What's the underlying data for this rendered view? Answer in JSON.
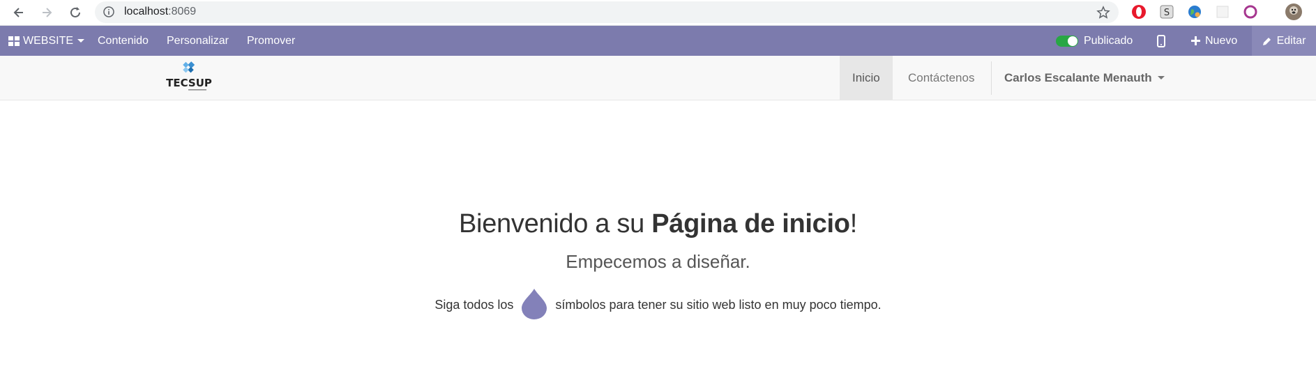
{
  "browser": {
    "url_host": "localhost",
    "url_port": ":8069",
    "icons": [
      "back-icon",
      "forward-icon",
      "reload-icon",
      "info-icon",
      "star-icon",
      "opera-icon",
      "s-extension-icon",
      "globe-extension-icon",
      "blank-extension-icon",
      "ring-extension-icon",
      "profile-avatar"
    ]
  },
  "odoo_bar": {
    "app_menu": "WEBSITE",
    "items": [
      "Contenido",
      "Personalizar",
      "Promover"
    ],
    "published_label": "Publicado",
    "new_label": "Nuevo",
    "edit_label": "Editar",
    "color": "#7c7bad"
  },
  "site_nav": {
    "logo_text": "TECSUP",
    "menu": [
      "Inicio",
      "Contáctenos"
    ],
    "active": "Inicio",
    "user": "Carlos Escalante Menauth"
  },
  "main": {
    "headline_pre": "Bienvenido a su ",
    "headline_bold": "Página de inicio",
    "headline_post": "!",
    "subheadline": "Empecemos a diseñar.",
    "tip_pre": "Siga todos los",
    "tip_post": "símbolos para tener su sitio web listo en muy poco tiempo.",
    "drop_color": "#8381b9"
  }
}
